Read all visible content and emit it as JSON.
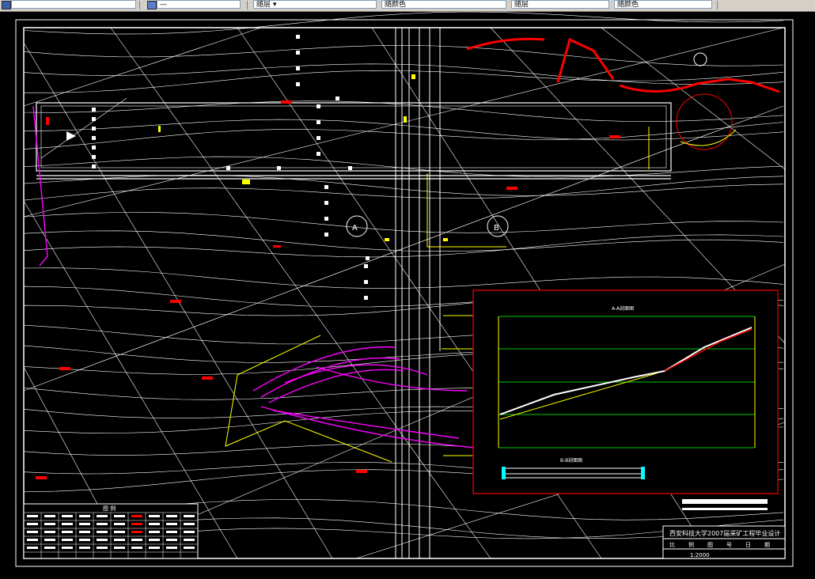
{
  "toolbar": {
    "fields": [
      {
        "id": "layer",
        "value": ""
      },
      {
        "id": "linetype",
        "value": "—"
      },
      {
        "id": "color",
        "value": "随层 ▾"
      },
      {
        "id": "lineweight",
        "value": "随颜色"
      },
      {
        "id": "plotstyle",
        "value": "随层"
      },
      {
        "id": "misc",
        "value": "随颜色"
      }
    ]
  },
  "drawing": {
    "inset_title_1": "A-A剖面图",
    "inset_title_2": "B-B剖面图",
    "section_marker_a": "A",
    "section_marker_b": "B",
    "legend_header": "图    例",
    "title_block_main": "西安科技大学2007届采矿工程毕业设计",
    "title_block_headers": [
      "比",
      "例",
      "图",
      "号",
      "日",
      "期"
    ],
    "scale_value": "1:2000",
    "colors": {
      "background": "#000000",
      "contour": "#ffffff",
      "grid": "#ffffff",
      "accent_red": "#ff0000",
      "accent_yellow": "#ffff00",
      "accent_magenta": "#ff00ff",
      "accent_green": "#00ff00",
      "accent_cyan": "#00ffff"
    }
  }
}
